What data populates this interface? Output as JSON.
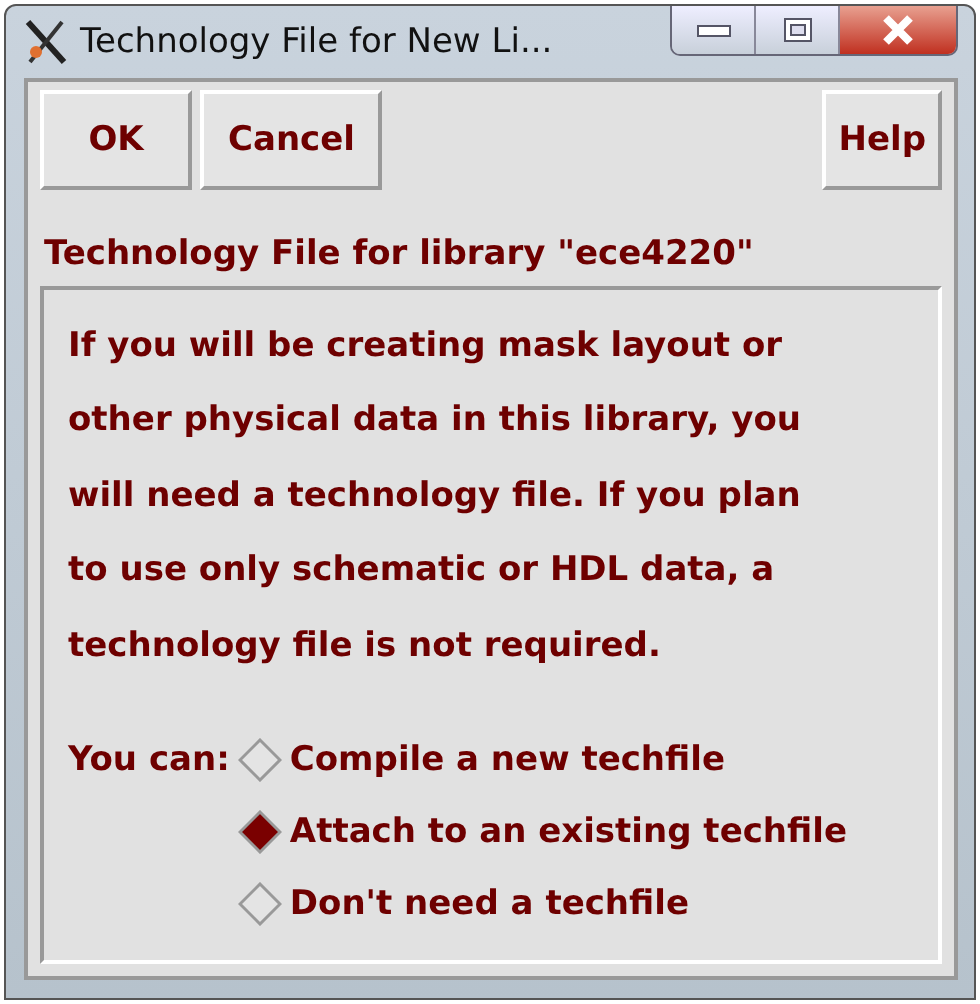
{
  "window": {
    "title": "Technology File for New Li..."
  },
  "buttons": [
    {
      "label": "OK"
    },
    {
      "label": "Cancel"
    }
  ],
  "help_button": {
    "label": "Help"
  },
  "section_title": "Technology File for library \"ece4220\"",
  "message": "If you will be creating mask layout or\nother physical data in this library, you\nwill need a technology file. If you plan\nto use only schematic or HDL data, a\ntechnology file is not required.",
  "options_label": "You can:",
  "options": [
    {
      "label": "Compile a new techfile",
      "selected": false
    },
    {
      "label": "Attach to an existing techfile",
      "selected": true
    },
    {
      "label": "Don't need a techfile",
      "selected": false
    }
  ]
}
